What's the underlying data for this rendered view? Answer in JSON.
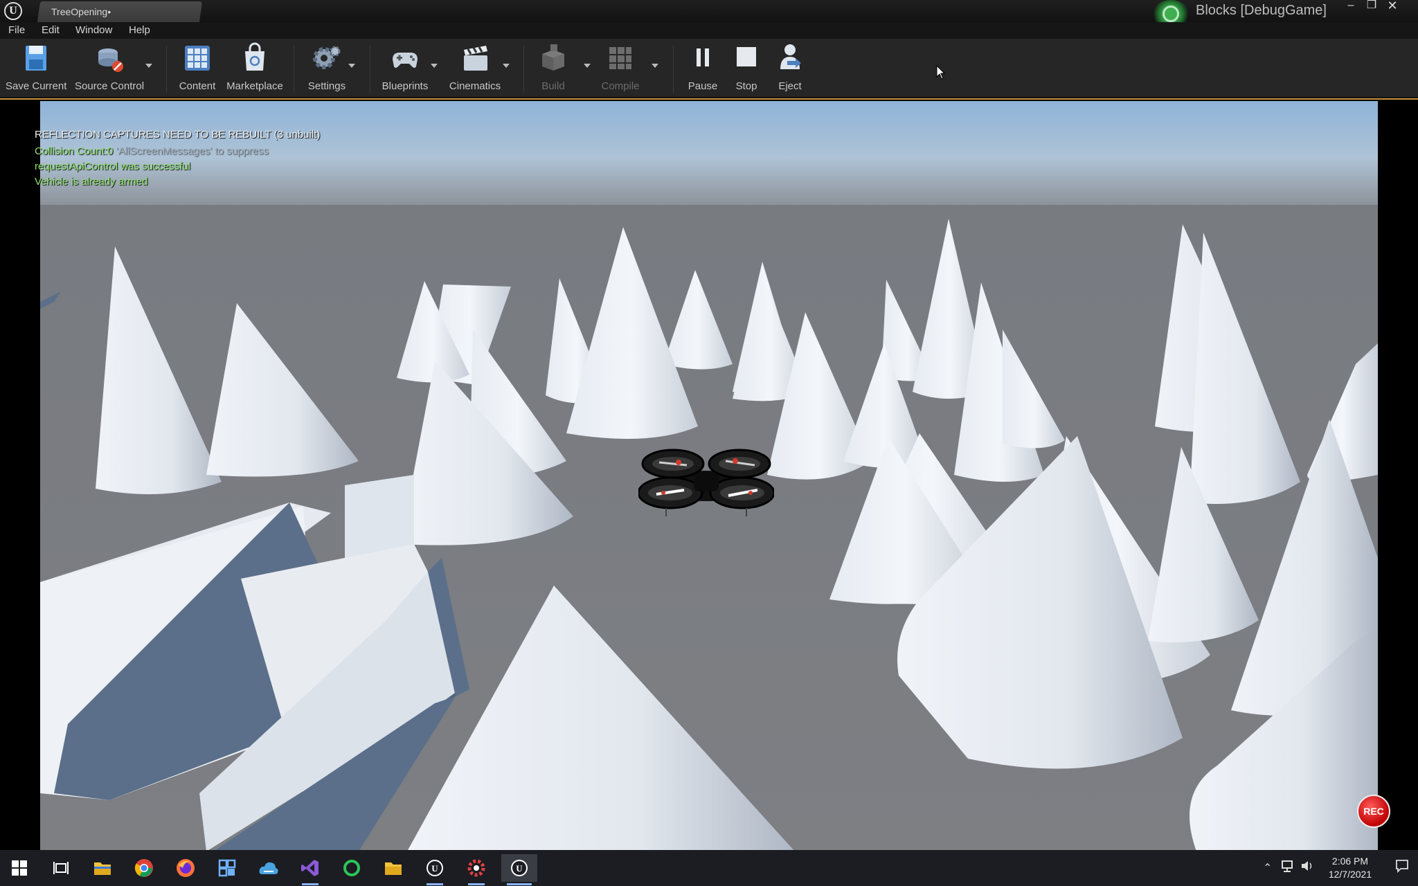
{
  "titlebar": {
    "tab_title": "TreeOpening•",
    "project_title": "Blocks [DebugGame]",
    "logo_text": "U"
  },
  "menu": [
    "File",
    "Edit",
    "Window",
    "Help"
  ],
  "toolbar": {
    "save": "Save Current",
    "source_control": "Source Control",
    "content": "Content",
    "marketplace": "Marketplace",
    "settings": "Settings",
    "blueprints": "Blueprints",
    "cinematics": "Cinematics",
    "build": "Build",
    "compile": "Compile",
    "pause": "Pause",
    "stop": "Stop",
    "eject": "Eject"
  },
  "viewport": {
    "messages": {
      "reflection": "REFLECTION CAPTURES NEED TO BE REBUILT (3 unbuilt)",
      "collision": "Collision Count:0",
      "collision_ghost": "'AllScreenMessages' to suppress",
      "api": "requestApiControl was successful",
      "armed": "Vehicle is already armed"
    },
    "rec_label": "REC"
  },
  "taskbar": {
    "time": "2:06 PM",
    "date": "12/7/2021"
  },
  "colors": {
    "accent_border": "#c8913a",
    "msg_white": "#f0f0f0",
    "msg_green": "#8fe36a",
    "msg_gray": "#9a9a9a"
  }
}
